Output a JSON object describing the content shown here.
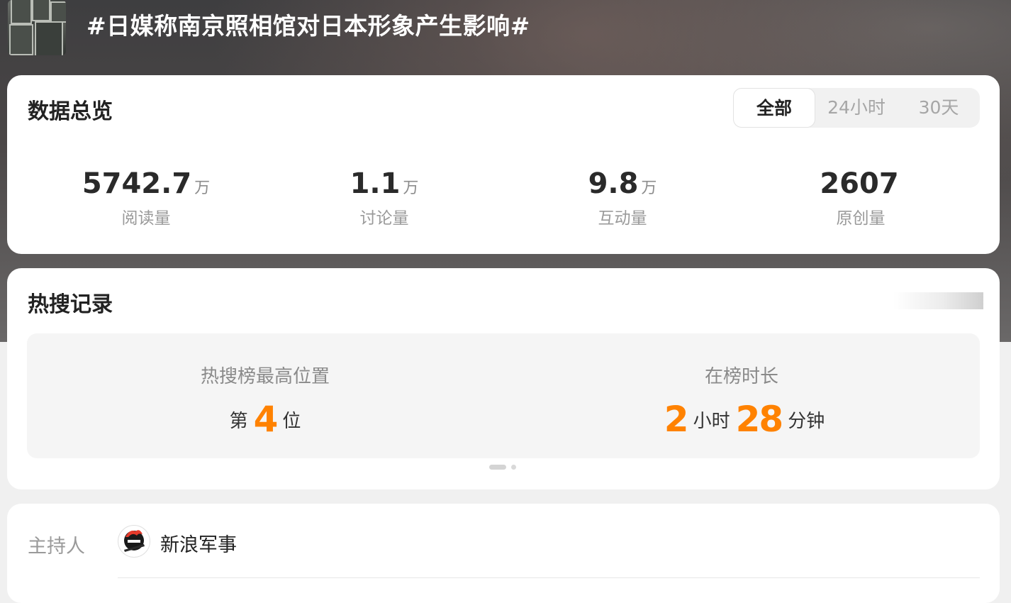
{
  "topic": {
    "title": "#日媒称南京照相馆对日本形象产生影响#",
    "thumbnail_icon": "movie-poster-thumbnail"
  },
  "overview": {
    "title": "数据总览",
    "tabs": [
      {
        "label": "全部",
        "active": true
      },
      {
        "label": "24小时",
        "active": false
      },
      {
        "label": "30天",
        "active": false
      }
    ],
    "stats": [
      {
        "value": "5742.7",
        "unit": "万",
        "label": "阅读量"
      },
      {
        "value": "1.1",
        "unit": "万",
        "label": "讨论量"
      },
      {
        "value": "9.8",
        "unit": "万",
        "label": "互动量"
      },
      {
        "value": "2607",
        "unit": "",
        "label": "原创量"
      }
    ]
  },
  "hot_search": {
    "title": "热搜记录",
    "peak": {
      "label": "热搜榜最高位置",
      "prefix": "第",
      "rank": "4",
      "suffix": "位"
    },
    "duration": {
      "label": "在榜时长",
      "hours": "2",
      "hours_unit": "小时",
      "minutes": "28",
      "minutes_unit": "分钟"
    },
    "pager": {
      "total_pages": 2,
      "current_page": 1
    }
  },
  "host": {
    "label": "主持人",
    "name": "新浪军事",
    "avatar_icon": "sina-military-logo"
  },
  "colors": {
    "accent": "#ff8200",
    "card_bg": "#ffffff",
    "page_bg": "#f0f0f0"
  }
}
